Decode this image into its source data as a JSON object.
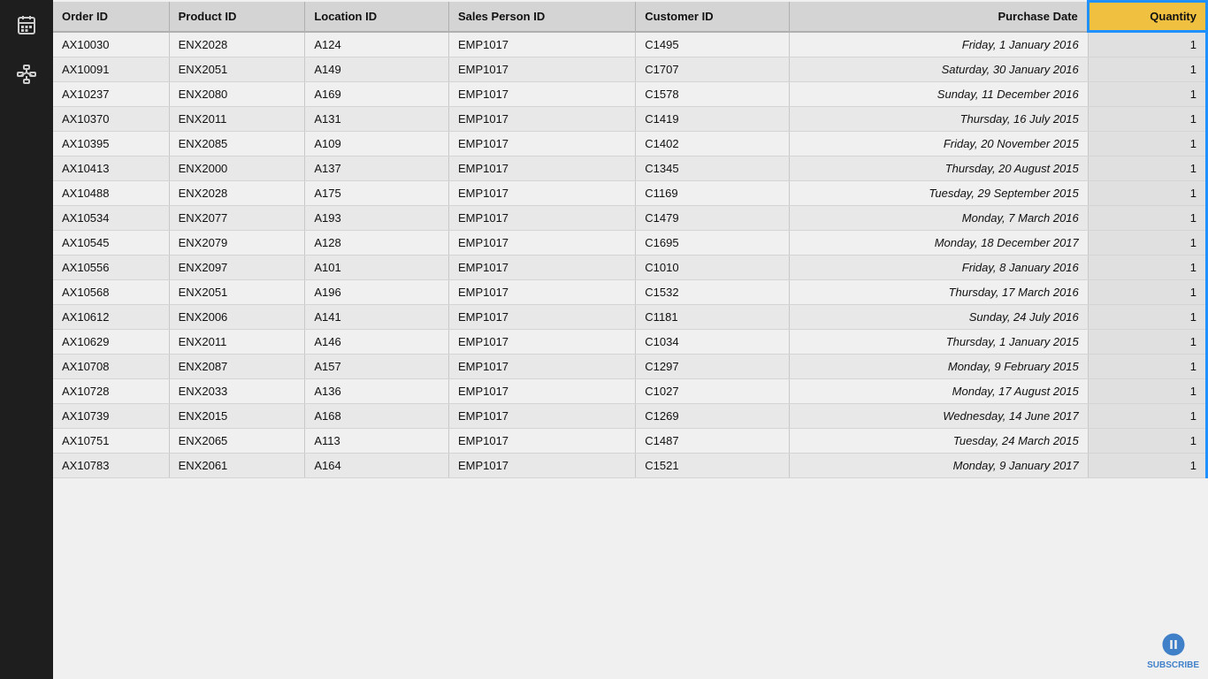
{
  "sidebar": {
    "icons": [
      {
        "name": "calendar-icon",
        "label": "Calendar"
      },
      {
        "name": "network-icon",
        "label": "Network/Hierarchy"
      }
    ]
  },
  "table": {
    "columns": [
      {
        "key": "order_id",
        "label": "Order ID"
      },
      {
        "key": "product_id",
        "label": "Product ID"
      },
      {
        "key": "location_id",
        "label": "Location ID"
      },
      {
        "key": "sales_person_id",
        "label": "Sales Person ID"
      },
      {
        "key": "customer_id",
        "label": "Customer ID"
      },
      {
        "key": "purchase_date",
        "label": "Purchase Date"
      },
      {
        "key": "quantity",
        "label": "Quantity"
      }
    ],
    "rows": [
      {
        "order_id": "AX10030",
        "product_id": "ENX2028",
        "location_id": "A124",
        "sales_person_id": "EMP1017",
        "customer_id": "C1495",
        "purchase_date": "Friday, 1 January 2016",
        "quantity": "1"
      },
      {
        "order_id": "AX10091",
        "product_id": "ENX2051",
        "location_id": "A149",
        "sales_person_id": "EMP1017",
        "customer_id": "C1707",
        "purchase_date": "Saturday, 30 January 2016",
        "quantity": "1"
      },
      {
        "order_id": "AX10237",
        "product_id": "ENX2080",
        "location_id": "A169",
        "sales_person_id": "EMP1017",
        "customer_id": "C1578",
        "purchase_date": "Sunday, 11 December 2016",
        "quantity": "1"
      },
      {
        "order_id": "AX10370",
        "product_id": "ENX2011",
        "location_id": "A131",
        "sales_person_id": "EMP1017",
        "customer_id": "C1419",
        "purchase_date": "Thursday, 16 July 2015",
        "quantity": "1"
      },
      {
        "order_id": "AX10395",
        "product_id": "ENX2085",
        "location_id": "A109",
        "sales_person_id": "EMP1017",
        "customer_id": "C1402",
        "purchase_date": "Friday, 20 November 2015",
        "quantity": "1"
      },
      {
        "order_id": "AX10413",
        "product_id": "ENX2000",
        "location_id": "A137",
        "sales_person_id": "EMP1017",
        "customer_id": "C1345",
        "purchase_date": "Thursday, 20 August 2015",
        "quantity": "1"
      },
      {
        "order_id": "AX10488",
        "product_id": "ENX2028",
        "location_id": "A175",
        "sales_person_id": "EMP1017",
        "customer_id": "C1169",
        "purchase_date": "Tuesday, 29 September 2015",
        "quantity": "1"
      },
      {
        "order_id": "AX10534",
        "product_id": "ENX2077",
        "location_id": "A193",
        "sales_person_id": "EMP1017",
        "customer_id": "C1479",
        "purchase_date": "Monday, 7 March 2016",
        "quantity": "1"
      },
      {
        "order_id": "AX10545",
        "product_id": "ENX2079",
        "location_id": "A128",
        "sales_person_id": "EMP1017",
        "customer_id": "C1695",
        "purchase_date": "Monday, 18 December 2017",
        "quantity": "1"
      },
      {
        "order_id": "AX10556",
        "product_id": "ENX2097",
        "location_id": "A101",
        "sales_person_id": "EMP1017",
        "customer_id": "C1010",
        "purchase_date": "Friday, 8 January 2016",
        "quantity": "1"
      },
      {
        "order_id": "AX10568",
        "product_id": "ENX2051",
        "location_id": "A196",
        "sales_person_id": "EMP1017",
        "customer_id": "C1532",
        "purchase_date": "Thursday, 17 March 2016",
        "quantity": "1"
      },
      {
        "order_id": "AX10612",
        "product_id": "ENX2006",
        "location_id": "A141",
        "sales_person_id": "EMP1017",
        "customer_id": "C1181",
        "purchase_date": "Sunday, 24 July 2016",
        "quantity": "1"
      },
      {
        "order_id": "AX10629",
        "product_id": "ENX2011",
        "location_id": "A146",
        "sales_person_id": "EMP1017",
        "customer_id": "C1034",
        "purchase_date": "Thursday, 1 January 2015",
        "quantity": "1"
      },
      {
        "order_id": "AX10708",
        "product_id": "ENX2087",
        "location_id": "A157",
        "sales_person_id": "EMP1017",
        "customer_id": "C1297",
        "purchase_date": "Monday, 9 February 2015",
        "quantity": "1"
      },
      {
        "order_id": "AX10728",
        "product_id": "ENX2033",
        "location_id": "A136",
        "sales_person_id": "EMP1017",
        "customer_id": "C1027",
        "purchase_date": "Monday, 17 August 2015",
        "quantity": "1"
      },
      {
        "order_id": "AX10739",
        "product_id": "ENX2015",
        "location_id": "A168",
        "sales_person_id": "EMP1017",
        "customer_id": "C1269",
        "purchase_date": "Wednesday, 14 June 2017",
        "quantity": "1"
      },
      {
        "order_id": "AX10751",
        "product_id": "ENX2065",
        "location_id": "A113",
        "sales_person_id": "EMP1017",
        "customer_id": "C1487",
        "purchase_date": "Tuesday, 24 March 2015",
        "quantity": "1"
      },
      {
        "order_id": "AX10783",
        "product_id": "ENX2061",
        "location_id": "A164",
        "sales_person_id": "EMP1017",
        "customer_id": "C1521",
        "purchase_date": "Monday, 9 January 2017",
        "quantity": "1"
      }
    ]
  },
  "subscribe": {
    "label": "SUBSCRIBE"
  }
}
